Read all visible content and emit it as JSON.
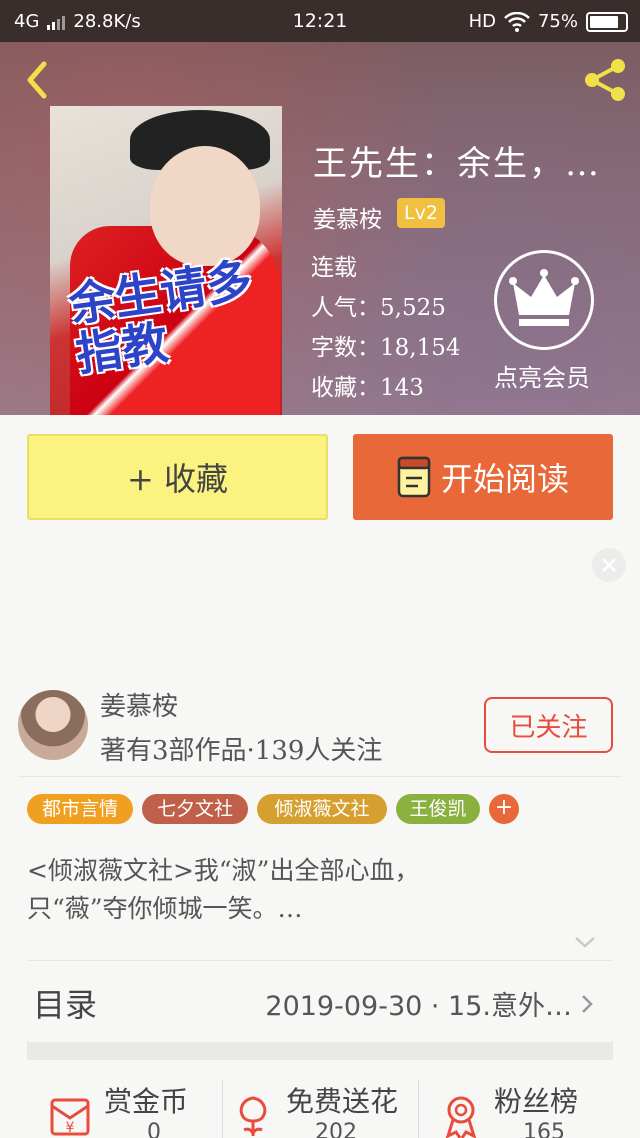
{
  "status_bar": {
    "network": "4G",
    "speed": "28.8K/s",
    "time": "12:21",
    "hd": "HD",
    "battery": "75%"
  },
  "header": {
    "back_icon": "back-chevron-icon",
    "share_icon": "share-icon"
  },
  "book": {
    "title": "王先生：余生，…",
    "author": "姜慕桉",
    "level": "Lv2",
    "status": "连载",
    "popularity_label": "人气：",
    "popularity": "5,525",
    "words_label": "字数：",
    "words": "18,154",
    "favorites_label": "收藏：",
    "favorites": "143",
    "cover_title": "余生请多指教"
  },
  "vip": {
    "label": "点亮会员",
    "icon": "crown-icon"
  },
  "actions": {
    "favorite": "+ 收藏",
    "read": "开始阅读",
    "read_icon": "book-icon"
  },
  "author_card": {
    "name": "姜慕桉",
    "info": "著有3部作品·139人关注",
    "follow": "已关注"
  },
  "tags": [
    {
      "label": "都市言情",
      "color": "#f0a020"
    },
    {
      "label": "七夕文社",
      "color": "#c0604a"
    },
    {
      "label": "倾淑薇文社",
      "color": "#d6a030"
    },
    {
      "label": "王俊凯",
      "color": "#8ab040"
    }
  ],
  "tag_more": "+",
  "description": {
    "line1": "<倾淑薇文社>我“淑”出全部心血，",
    "line2": "只“薇”夺你倾城一笑。…"
  },
  "toc": {
    "label": "目录",
    "latest": "2019-09-30 · 15.意外…"
  },
  "bottom": [
    {
      "label": "赏金币",
      "value": "0",
      "icon": "coin-envelope-icon"
    },
    {
      "label": "免费送花",
      "value": "202",
      "icon": "flower-icon"
    },
    {
      "label": "粉丝榜",
      "value": "165",
      "icon": "medal-icon"
    }
  ]
}
